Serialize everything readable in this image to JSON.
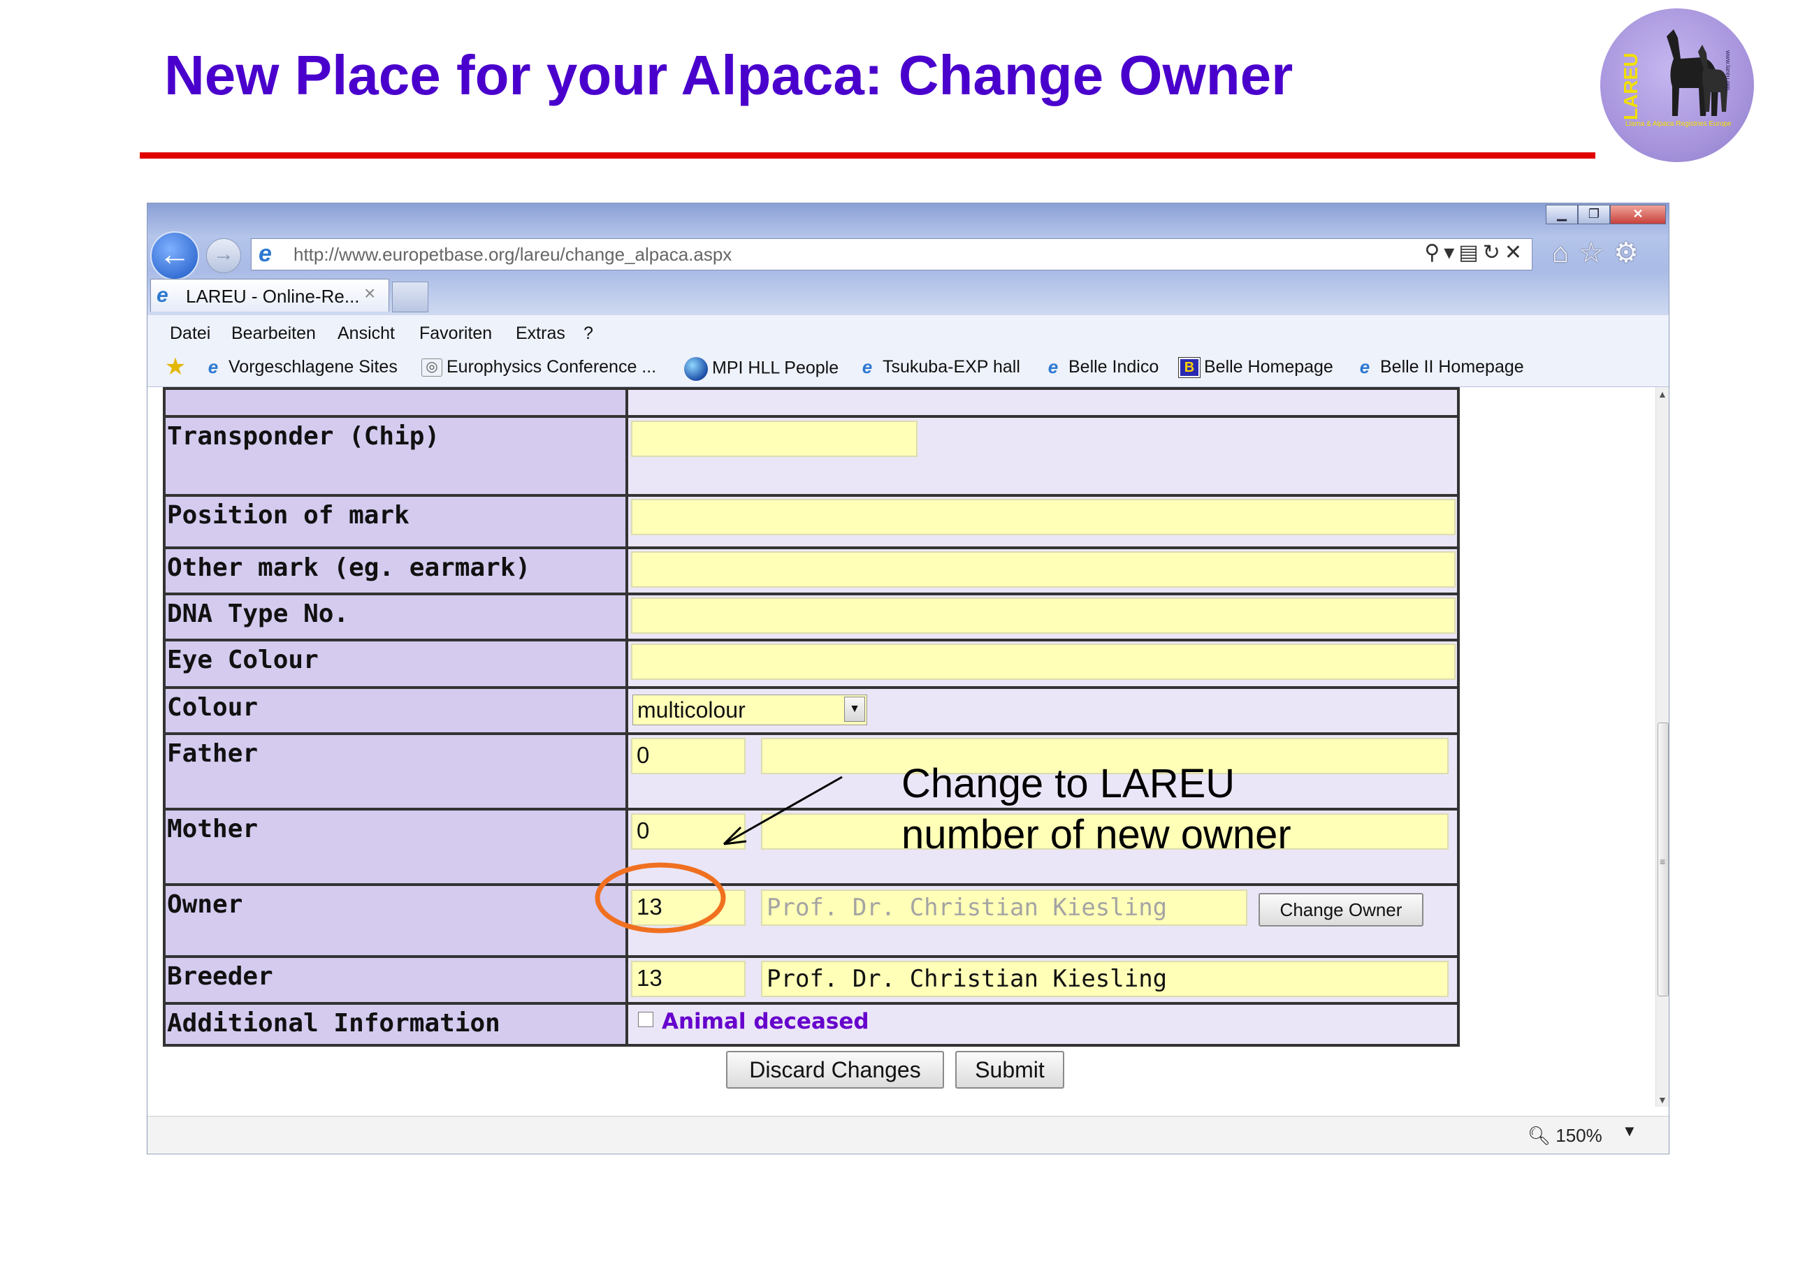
{
  "slide": {
    "title": "New Place for your Alpaca: Change Owner",
    "logo_text": "LAREU",
    "logo_subtext": "Llama & Alpaca Registries Europe",
    "logo_url": "www.lareu.org"
  },
  "browser": {
    "address_url": "http://www.europetbase.org/lareu/change_alpaca.aspx",
    "tab_label": "LAREU - Online-Re...",
    "menu": [
      "Datei",
      "Bearbeiten",
      "Ansicht",
      "Favoriten",
      "Extras",
      "?"
    ],
    "favorites": [
      {
        "label": "Vorgeschlagene Sites",
        "icon": "ie-icon"
      },
      {
        "label": "Europhysics Conference ...",
        "icon": "eye-icon"
      },
      {
        "label": "MPI HLL People",
        "icon": "globe-icon"
      },
      {
        "label": "Tsukuba-EXP hall",
        "icon": "ie-icon"
      },
      {
        "label": "Belle Indico",
        "icon": "ie-icon"
      },
      {
        "label": "Belle Homepage",
        "icon": "b-icon"
      },
      {
        "label": "Belle II Homepage",
        "icon": "ie-icon"
      }
    ],
    "zoom": "150%"
  },
  "form": {
    "transponder_label": "Transponder (Chip)",
    "transponder_value": "",
    "position_label": "Position of mark",
    "position_value": "",
    "other_mark_label": "Other mark (eg. earmark)",
    "other_mark_value": "",
    "dna_label": "DNA Type No.",
    "dna_value": "",
    "eye_label": "Eye Colour",
    "eye_value": "",
    "colour_label": "Colour",
    "colour_value": "multicolour",
    "father_label": "Father",
    "father_id": "0",
    "father_name": "",
    "mother_label": "Mother",
    "mother_id": "0",
    "mother_name": "",
    "owner_label": "Owner",
    "owner_id": "13",
    "owner_name": "Prof. Dr. Christian Kiesling",
    "change_owner_button": "Change Owner",
    "breeder_label": "Breeder",
    "breeder_id": "13",
    "breeder_name": "Prof. Dr. Christian Kiesling",
    "additional_label": "Additional Information",
    "deceased_label": "Animal deceased",
    "deceased_checked": false,
    "discard_button": "Discard Changes",
    "submit_button": "Submit"
  },
  "annotation": {
    "line1": "Change to LAREU",
    "line2": "number of new owner",
    "circle_color": "#f07020"
  },
  "colors": {
    "title": "#4a00cc",
    "rule": "#e00000",
    "label_bg": "#d4cbef",
    "input_bg": "#ffffb8",
    "deceased_text": "#6600cc"
  }
}
